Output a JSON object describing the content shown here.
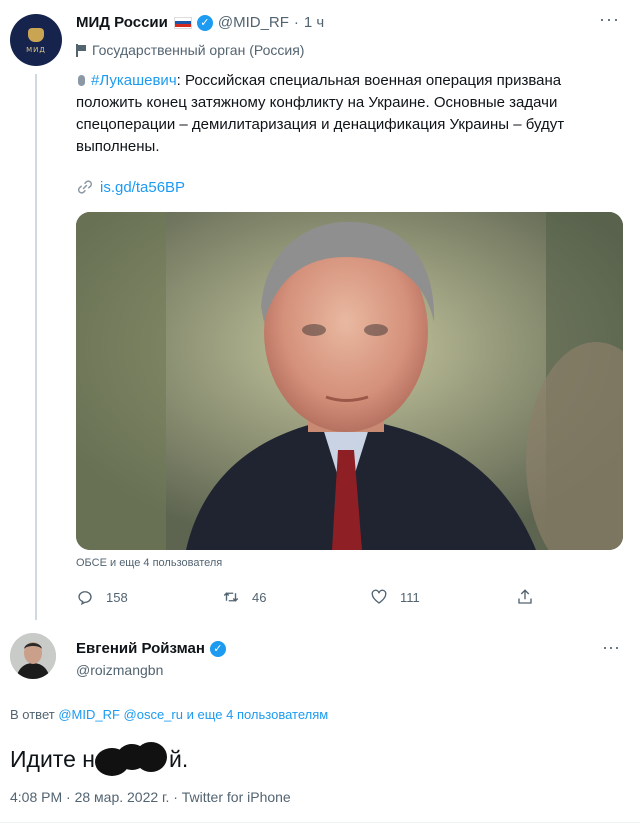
{
  "tweet1": {
    "author_name": "МИД России",
    "handle": "@MID_RF",
    "separator": "·",
    "time": "1 ч",
    "label": "Государственный орган (Россия)",
    "hashtag": "#Лукашевич",
    "body": ": Российская специальная военная операция призвана положить конец затяжному конфликту на Украине. Основные задачи спецоперации – демилитаризация и денацификация Украины – будут выполнены.",
    "link": "is.gd/ta56BP",
    "liked_by": "ОБСЕ и еще 4 пользователя",
    "replies": "158",
    "retweets": "46",
    "likes": "111",
    "more": "···",
    "flag_colors": [
      "#ffffff",
      "#1c57a7",
      "#d52b1e"
    ]
  },
  "tweet2": {
    "author_name": "Евгений Ройзман",
    "handle": "@roizmangbn",
    "more": "···",
    "reply_prefix": "В ответ",
    "reply_mentions": "@MID_RF @osce_ru",
    "reply_suffix": "и еще 4 пользователям",
    "text_before": "Идите н",
    "text_after": "й.",
    "meta": "4:08 PM · 28 мар. 2022 г. · Twitter for iPhone"
  },
  "colors": {
    "accent": "#1d9bf0",
    "text": "#0f1419",
    "muted": "#536471"
  },
  "icons": [
    "flag-icon",
    "verified-icon",
    "microphone-icon",
    "link-icon",
    "reply-icon",
    "retweet-icon",
    "like-icon",
    "share-icon"
  ]
}
